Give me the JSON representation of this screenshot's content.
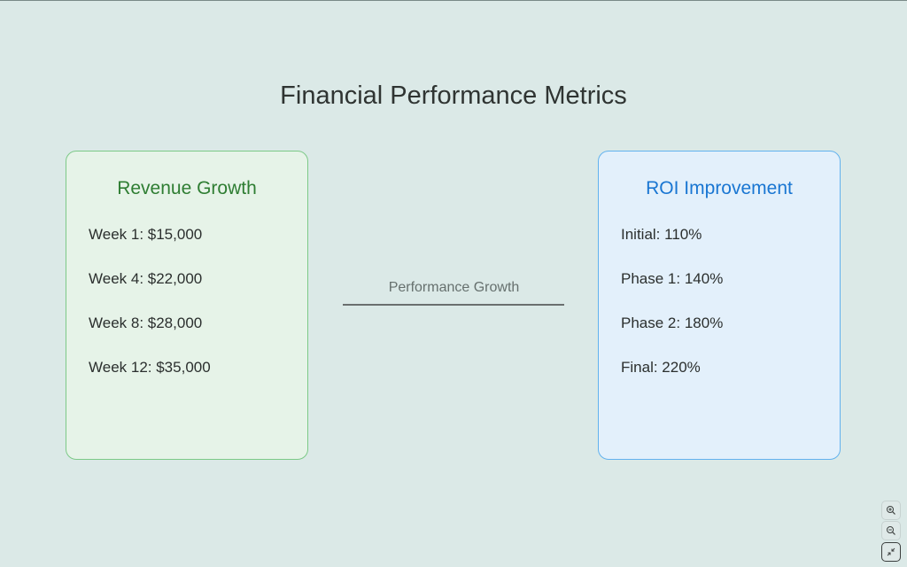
{
  "title": "Financial Performance Metrics",
  "cards": {
    "revenue": {
      "title": "Revenue Growth",
      "items": [
        "Week 1: $15,000",
        "Week 4: $22,000",
        "Week 8: $28,000",
        "Week 12: $35,000"
      ],
      "accent": "#2e7d32",
      "background": "#e6f3e8",
      "border": "#7cc987"
    },
    "roi": {
      "title": "ROI Improvement",
      "items": [
        "Initial: 110%",
        "Phase 1: 140%",
        "Phase 2: 180%",
        "Final: 220%"
      ],
      "accent": "#1976d2",
      "background": "#e3f0fb",
      "border": "#62b2ee"
    }
  },
  "connector": {
    "label": "Performance Growth"
  },
  "controls": {
    "zoom_in_icon": "zoom-in-icon",
    "zoom_out_icon": "zoom-out-icon",
    "fit_icon": "collapse-arrows-icon"
  },
  "colors": {
    "background": "#dbe9e7",
    "title": "#2f3432",
    "text": "#2b2f2e",
    "connector_line": "#6a6f6e"
  }
}
